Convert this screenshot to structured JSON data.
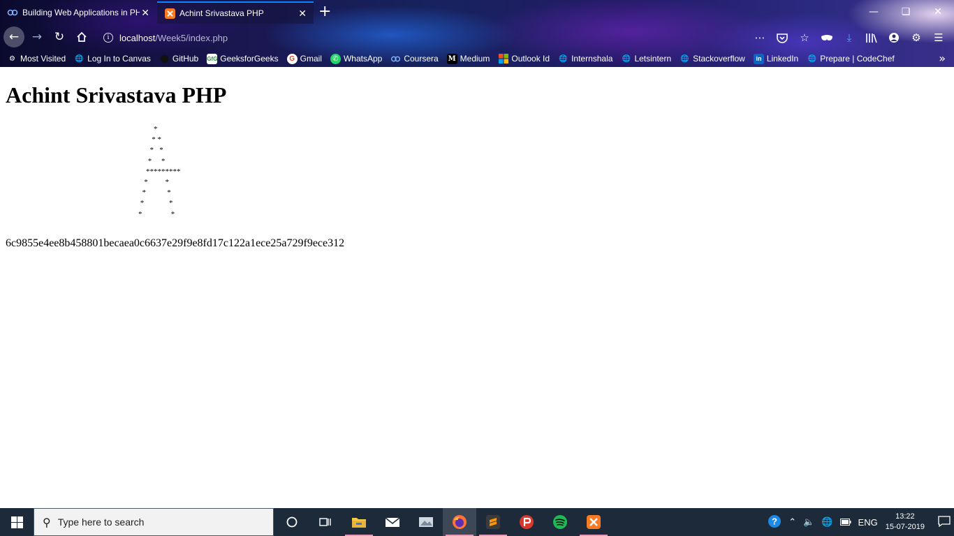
{
  "browser": {
    "tabs": [
      {
        "title": "Building Web Applications in PHP",
        "icon": "coursera-icon",
        "active": false
      },
      {
        "title": "Achint Srivastava PHP",
        "icon": "xampp-icon",
        "active": true
      }
    ],
    "url": {
      "host": "localhost",
      "path": "/Week5/index.php"
    },
    "bookmarks": [
      {
        "label": "Most Visited",
        "icon": "gear-icon"
      },
      {
        "label": "Log In to Canvas",
        "icon": "globe-icon"
      },
      {
        "label": "GitHub",
        "icon": "github-icon"
      },
      {
        "label": "GeeksforGeeks",
        "icon": "gfg-icon"
      },
      {
        "label": "Gmail",
        "icon": "google-icon"
      },
      {
        "label": "WhatsApp",
        "icon": "whatsapp-icon"
      },
      {
        "label": "Coursera",
        "icon": "coursera-icon"
      },
      {
        "label": "Medium",
        "icon": "medium-icon"
      },
      {
        "label": "Outlook Id",
        "icon": "windows-icon"
      },
      {
        "label": "Internshala",
        "icon": "globe-icon"
      },
      {
        "label": "Letsintern",
        "icon": "globe-icon"
      },
      {
        "label": "Stackoverflow",
        "icon": "globe-icon"
      },
      {
        "label": "LinkedIn",
        "icon": "linkedin-icon"
      },
      {
        "label": "Prepare | CodeChef",
        "icon": "globe-icon"
      }
    ]
  },
  "page": {
    "heading": "Achint Srivastava PHP",
    "ascii_art": "        *\n       * *\n      *   *\n     *     *\n    *********\n   *         *\n  *           *\n *             *\n*               *",
    "hash": "6c9855e4ee8b458801becaea0c6637e29f9e8fd17c122a1ece25a729f9ece312"
  },
  "taskbar": {
    "search_placeholder": "Type here to search",
    "language": "ENG",
    "time": "13:22",
    "date": "15-07-2019",
    "apps": [
      "cortana-icon",
      "task-view-icon",
      "file-explorer-icon",
      "mail-icon",
      "photos-icon",
      "firefox-icon",
      "sublime-text-icon",
      "psiphon-icon",
      "spotify-icon",
      "xampp-icon"
    ]
  },
  "colors": {
    "accent": "#0a84ff",
    "taskbar": "#1c2a3a",
    "spotify": "#1db954",
    "xampp": "#fb7a24"
  }
}
